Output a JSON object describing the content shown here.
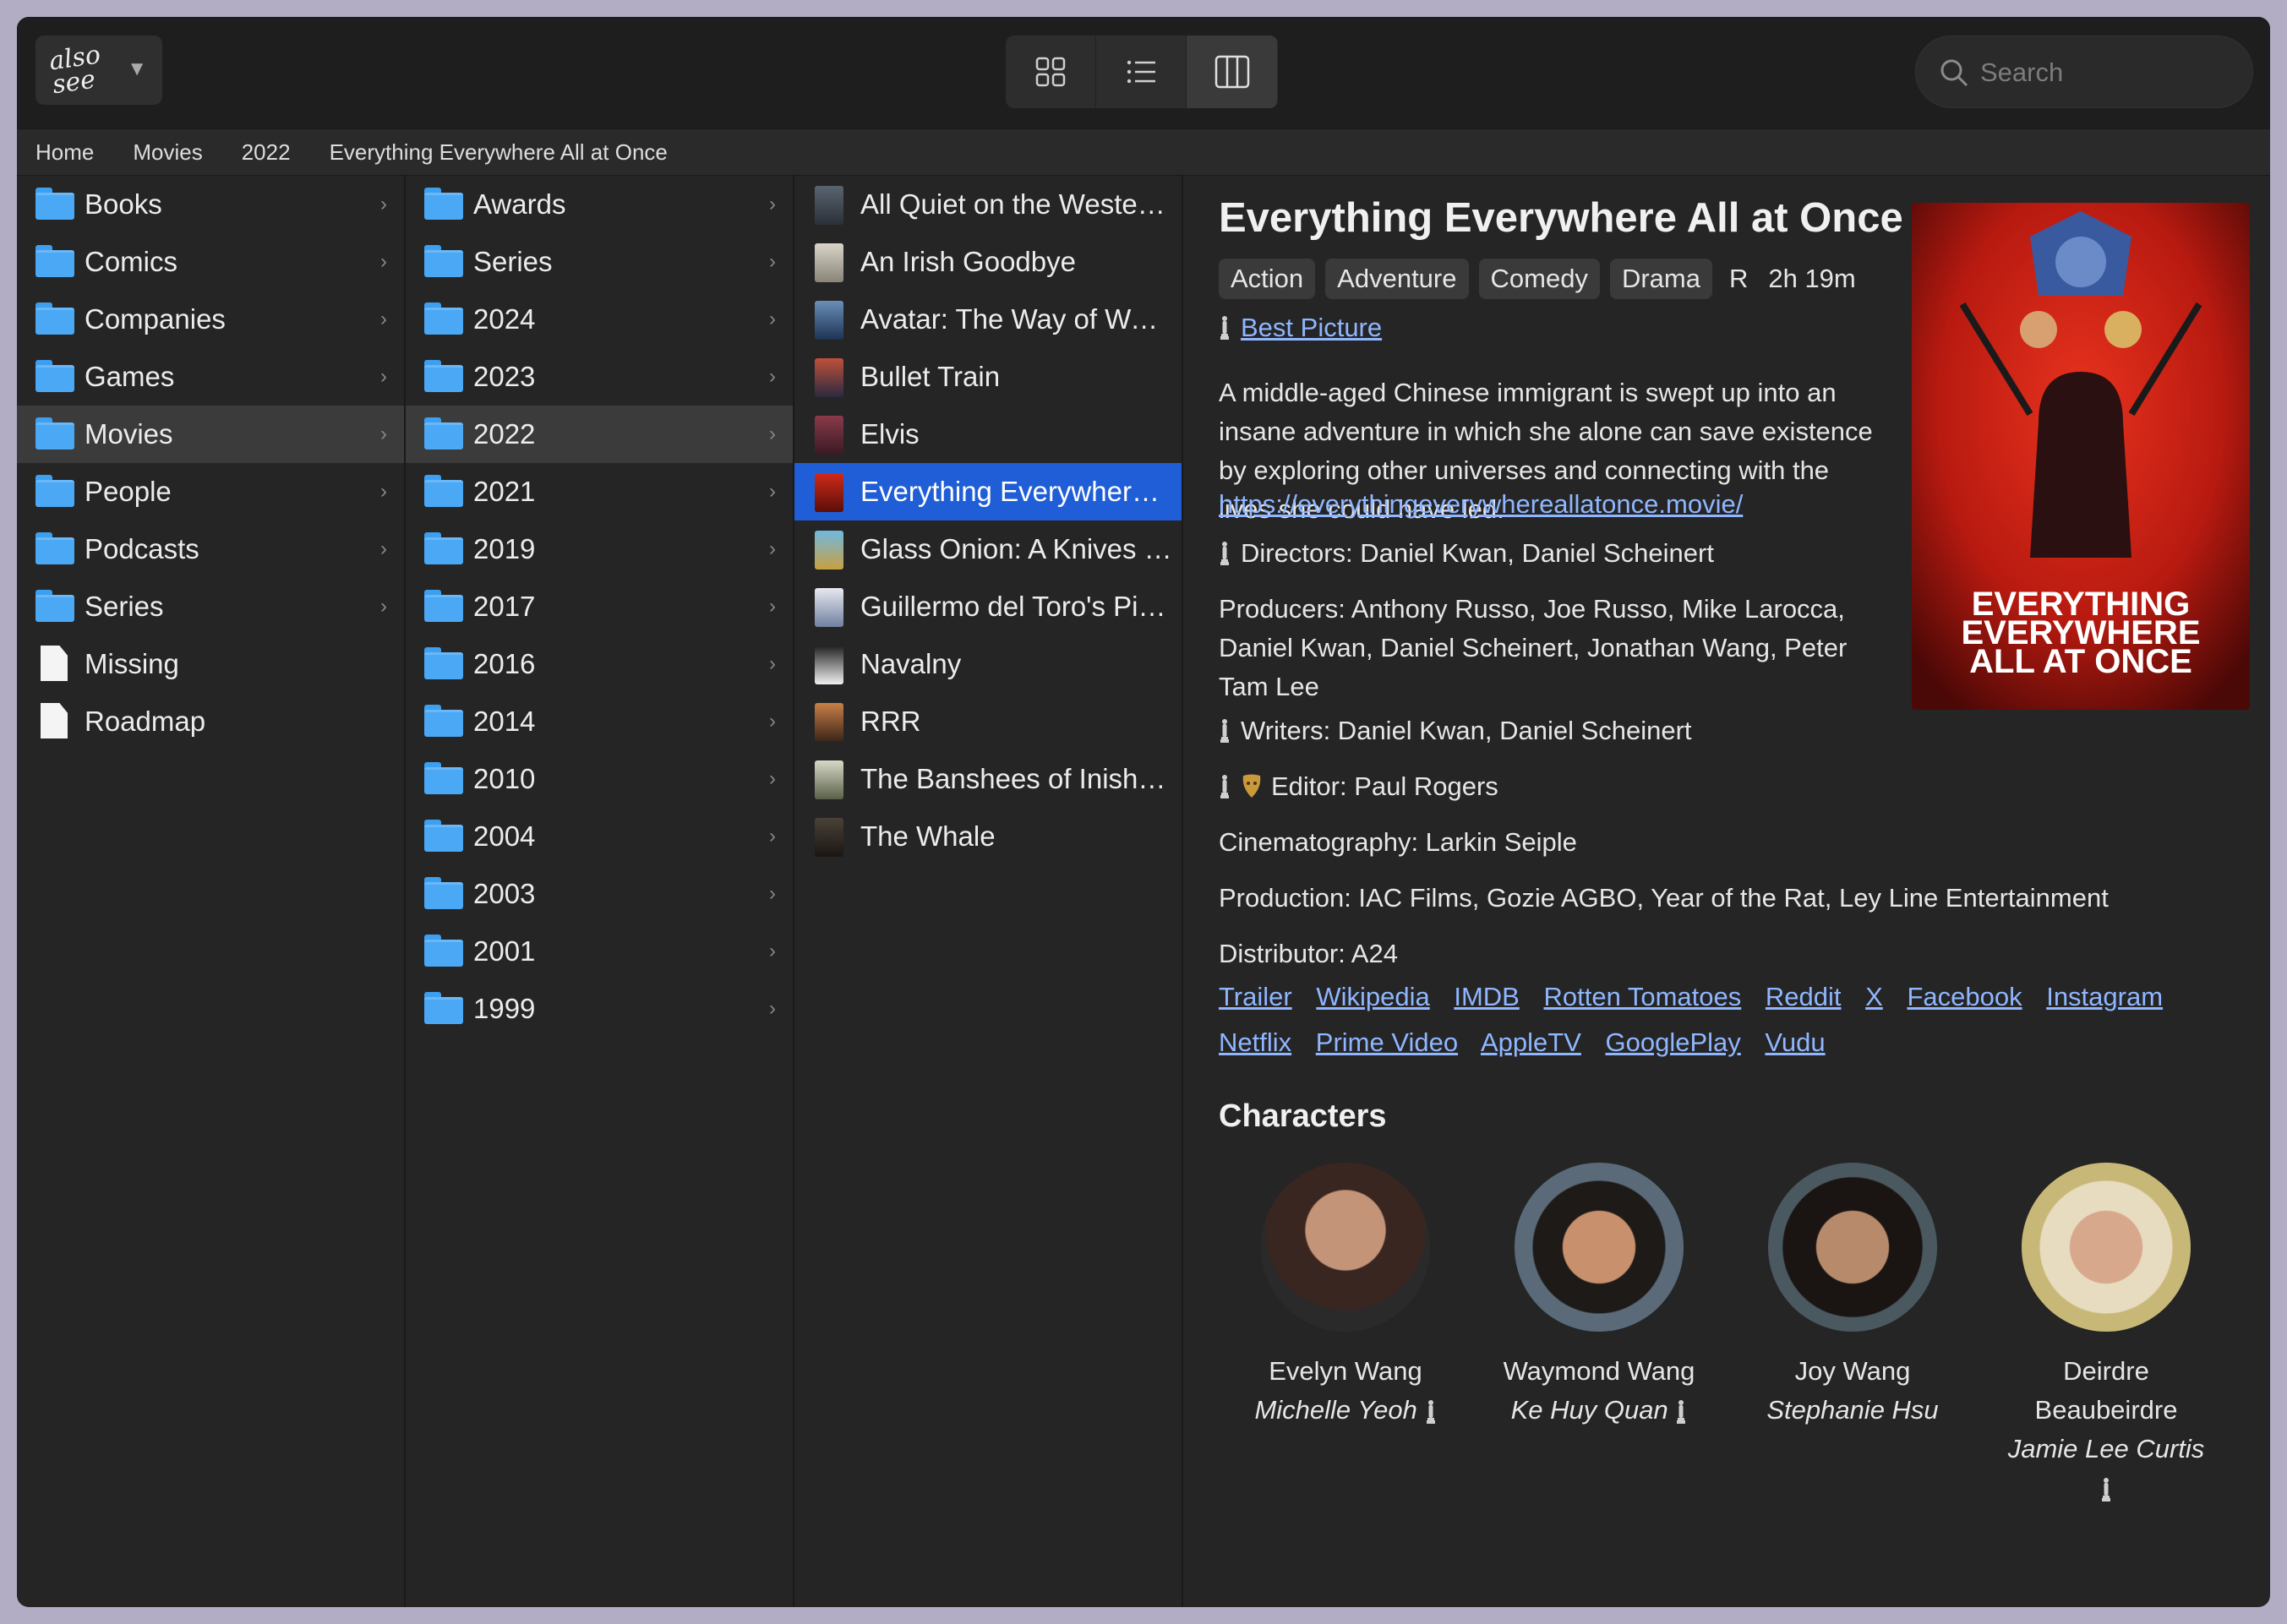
{
  "toolbar": {
    "logo_text": "also see",
    "search_placeholder": "Search",
    "views": [
      "grid-view-icon",
      "list-view-icon",
      "columns-view-icon"
    ]
  },
  "breadcrumb": [
    "Home",
    "Movies",
    "2022",
    "Everything Everywhere All at Once"
  ],
  "col1": [
    {
      "label": "Books",
      "type": "folder"
    },
    {
      "label": "Comics",
      "type": "folder"
    },
    {
      "label": "Companies",
      "type": "folder"
    },
    {
      "label": "Games",
      "type": "folder"
    },
    {
      "label": "Movies",
      "type": "folder"
    },
    {
      "label": "People",
      "type": "folder"
    },
    {
      "label": "Podcasts",
      "type": "folder"
    },
    {
      "label": "Series",
      "type": "folder"
    },
    {
      "label": "Missing",
      "type": "doc"
    },
    {
      "label": "Roadmap",
      "type": "doc"
    }
  ],
  "col2": [
    "Awards",
    "Series",
    "2024",
    "2023",
    "2022",
    "2021",
    "2019",
    "2017",
    "2016",
    "2014",
    "2010",
    "2004",
    "2003",
    "2001",
    "1999"
  ],
  "col3": [
    "All Quiet on the Western Front",
    "An Irish Goodbye",
    "Avatar: The Way of Water",
    "Bullet Train",
    "Elvis",
    "Everything Everywhere All at Once",
    "Glass Onion: A Knives Out Mystery",
    "Guillermo del Toro's Pinocchio",
    "Navalny",
    "RRR",
    "The Banshees of Inisherin",
    "The Whale"
  ],
  "detail": {
    "title": "Everything Everywhere All at Once",
    "genres": [
      "Action",
      "Adventure",
      "Comedy",
      "Drama"
    ],
    "rating": "R",
    "runtime": "2h 19m",
    "award": "Best Picture",
    "synopsis": "A middle-aged Chinese immigrant is swept up into an insane adventure in which she alone can save existence by exploring other universes and connecting with the lives she could have led.",
    "url": "https://everythingeverywhereallatonce.movie/",
    "directors": "Directors: Daniel Kwan, Daniel Scheinert",
    "producers": "Producers: Anthony Russo, Joe Russo, Mike Larocca, Daniel Kwan, Daniel Scheinert, Jonathan Wang, Peter Tam Lee",
    "writers": "Writers: Daniel Kwan, Daniel Scheinert",
    "editor": "Editor: Paul Rogers",
    "cinematography": "Cinematography: Larkin Seiple",
    "production": "Production: IAC Films, Gozie AGBO, Year of the Rat, Ley Line Entertainment",
    "distributor": "Distributor: A24",
    "links_row1": [
      "Trailer",
      "Wikipedia",
      "IMDB",
      "Rotten Tomatoes",
      "Reddit",
      "X",
      "Facebook",
      "Instagram"
    ],
    "links_row2": [
      "Netflix",
      "Prime Video",
      "AppleTV",
      "GooglePlay",
      "Vudu"
    ],
    "characters_heading": "Characters",
    "poster_text": "EVERYTHING EVERYWHERE ALL AT ONCE",
    "characters": [
      {
        "name": "Evelyn Wang",
        "actor": "Michelle Yeoh",
        "oscar": true
      },
      {
        "name": "Waymond Wang",
        "actor": "Ke Huy Quan",
        "oscar": true
      },
      {
        "name": "Joy Wang",
        "actor": "Stephanie Hsu",
        "oscar": false
      },
      {
        "name": "Deirdre Beaubeirdre",
        "actor": "Jamie Lee Curtis",
        "oscar": true
      }
    ]
  },
  "colors": {
    "selection": "#1f5ed6",
    "link": "#8fb6ff",
    "folder": "#4aa8f5"
  }
}
